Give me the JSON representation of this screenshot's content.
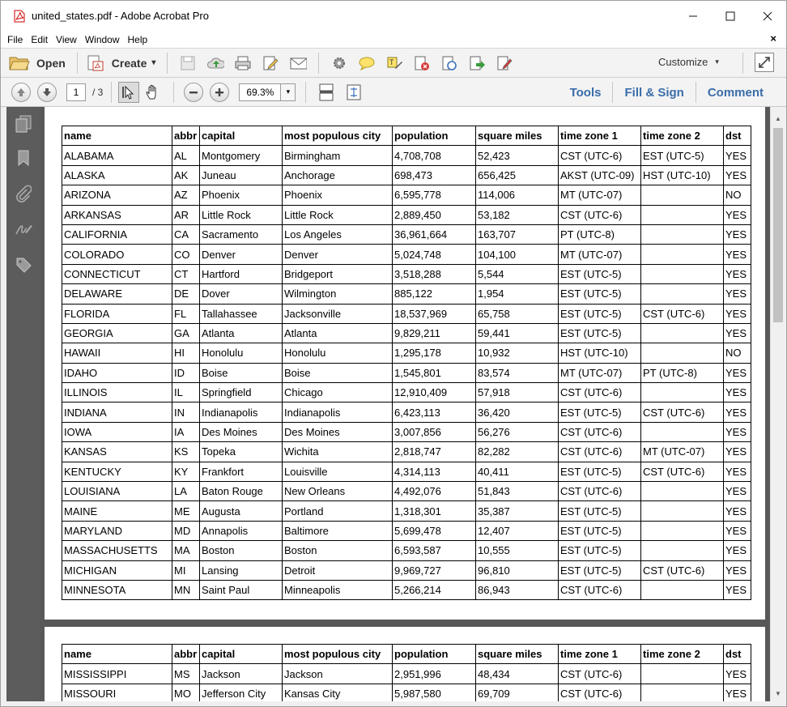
{
  "window": {
    "title": "united_states.pdf - Adobe Acrobat Pro",
    "min": "—",
    "max": "☐",
    "close": "✕"
  },
  "menu": {
    "items": [
      "File",
      "Edit",
      "View",
      "Window",
      "Help"
    ],
    "close": "×"
  },
  "toolbar": {
    "open": "Open",
    "create": "Create",
    "create_arrow": "▾",
    "customize": "Customize",
    "customize_arrow": "▾"
  },
  "nav": {
    "page_value": "1",
    "page_total": "/ 3",
    "zoom_value": "69.3%",
    "zoom_arrow": "▾"
  },
  "panels": {
    "tools": "Tools",
    "fill_sign": "Fill & Sign",
    "comment": "Comment"
  },
  "table": {
    "headers": [
      "name",
      "abbr",
      "capital",
      "most populous city",
      "population",
      "square miles",
      "time zone 1",
      "time zone 2",
      "dst"
    ],
    "page1": [
      [
        "ALABAMA",
        "AL",
        "Montgomery",
        "Birmingham",
        "4,708,708",
        "52,423",
        "CST (UTC-6)",
        "EST (UTC-5)",
        "YES"
      ],
      [
        "ALASKA",
        "AK",
        "Juneau",
        "Anchorage",
        "698,473",
        "656,425",
        "AKST (UTC-09)",
        "HST (UTC-10)",
        "YES"
      ],
      [
        "ARIZONA",
        "AZ",
        "Phoenix",
        "Phoenix",
        "6,595,778",
        "114,006",
        "MT (UTC-07)",
        "",
        "NO"
      ],
      [
        "ARKANSAS",
        "AR",
        "Little Rock",
        "Little Rock",
        "2,889,450",
        "53,182",
        "CST (UTC-6)",
        "",
        "YES"
      ],
      [
        "CALIFORNIA",
        "CA",
        "Sacramento",
        "Los Angeles",
        "36,961,664",
        "163,707",
        "PT (UTC-8)",
        "",
        "YES"
      ],
      [
        "COLORADO",
        "CO",
        "Denver",
        "Denver",
        "5,024,748",
        "104,100",
        "MT (UTC-07)",
        "",
        "YES"
      ],
      [
        "CONNECTICUT",
        "CT",
        "Hartford",
        "Bridgeport",
        "3,518,288",
        "5,544",
        "EST (UTC-5)",
        "",
        "YES"
      ],
      [
        "DELAWARE",
        "DE",
        "Dover",
        "Wilmington",
        "885,122",
        "1,954",
        "EST (UTC-5)",
        "",
        "YES"
      ],
      [
        "FLORIDA",
        "FL",
        "Tallahassee",
        "Jacksonville",
        "18,537,969",
        "65,758",
        "EST (UTC-5)",
        "CST (UTC-6)",
        "YES"
      ],
      [
        "GEORGIA",
        "GA",
        "Atlanta",
        "Atlanta",
        "9,829,211",
        "59,441",
        "EST (UTC-5)",
        "",
        "YES"
      ],
      [
        "HAWAII",
        "HI",
        "Honolulu",
        "Honolulu",
        "1,295,178",
        "10,932",
        "HST (UTC-10)",
        "",
        "NO"
      ],
      [
        "IDAHO",
        "ID",
        "Boise",
        "Boise",
        "1,545,801",
        "83,574",
        "MT (UTC-07)",
        "PT (UTC-8)",
        "YES"
      ],
      [
        "ILLINOIS",
        "IL",
        "Springfield",
        "Chicago",
        "12,910,409",
        "57,918",
        "CST (UTC-6)",
        "",
        "YES"
      ],
      [
        "INDIANA",
        "IN",
        "Indianapolis",
        "Indianapolis",
        "6,423,113",
        "36,420",
        "EST (UTC-5)",
        "CST (UTC-6)",
        "YES"
      ],
      [
        "IOWA",
        "IA",
        "Des Moines",
        "Des Moines",
        "3,007,856",
        "56,276",
        "CST (UTC-6)",
        "",
        "YES"
      ],
      [
        "KANSAS",
        "KS",
        "Topeka",
        "Wichita",
        "2,818,747",
        "82,282",
        "CST (UTC-6)",
        "MT (UTC-07)",
        "YES"
      ],
      [
        "KENTUCKY",
        "KY",
        "Frankfort",
        "Louisville",
        "4,314,113",
        "40,411",
        "EST (UTC-5)",
        "CST (UTC-6)",
        "YES"
      ],
      [
        "LOUISIANA",
        "LA",
        "Baton Rouge",
        "New Orleans",
        "4,492,076",
        "51,843",
        "CST (UTC-6)",
        "",
        "YES"
      ],
      [
        "MAINE",
        "ME",
        "Augusta",
        "Portland",
        "1,318,301",
        "35,387",
        "EST (UTC-5)",
        "",
        "YES"
      ],
      [
        "MARYLAND",
        "MD",
        "Annapolis",
        "Baltimore",
        "5,699,478",
        "12,407",
        "EST (UTC-5)",
        "",
        "YES"
      ],
      [
        "MASSACHUSETTS",
        "MA",
        "Boston",
        "Boston",
        "6,593,587",
        "10,555",
        "EST (UTC-5)",
        "",
        "YES"
      ],
      [
        "MICHIGAN",
        "MI",
        "Lansing",
        "Detroit",
        "9,969,727",
        "96,810",
        "EST (UTC-5)",
        "CST (UTC-6)",
        "YES"
      ],
      [
        "MINNESOTA",
        "MN",
        "Saint Paul",
        "Minneapolis",
        "5,266,214",
        "86,943",
        "CST (UTC-6)",
        "",
        "YES"
      ]
    ],
    "page2": [
      [
        "MISSISSIPPI",
        "MS",
        "Jackson",
        "Jackson",
        "2,951,996",
        "48,434",
        "CST (UTC-6)",
        "",
        "YES"
      ],
      [
        "MISSOURI",
        "MO",
        "Jefferson City",
        "Kansas City",
        "5,987,580",
        "69,709",
        "CST (UTC-6)",
        "",
        "YES"
      ]
    ]
  },
  "scrollbar": {
    "up": "▲",
    "down": "▼"
  }
}
